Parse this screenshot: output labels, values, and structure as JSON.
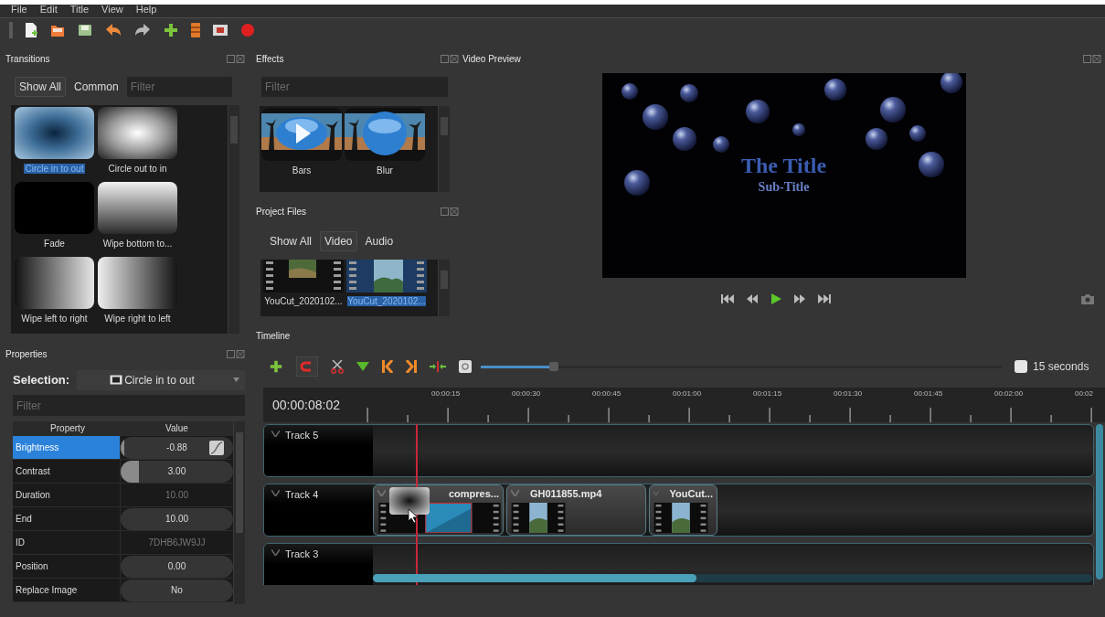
{
  "menu": [
    {
      "label": "File"
    },
    {
      "label": "Edit"
    },
    {
      "label": "Title"
    },
    {
      "label": "View"
    },
    {
      "label": "Help"
    }
  ],
  "transitions": {
    "title": "Transitions",
    "tabs": [
      {
        "label": "Show All",
        "selected": true
      },
      {
        "label": "Common",
        "selected": false
      }
    ],
    "filter": {
      "placeholder": "Filter"
    },
    "items": [
      {
        "label": "Circle in to out",
        "kind": "circle-in",
        "selected": true
      },
      {
        "label": "Circle out to in",
        "kind": "circle-out",
        "selected": false
      },
      {
        "label": "Fade",
        "kind": "fade",
        "selected": false
      },
      {
        "label": "Wipe bottom to...",
        "kind": "wipe-bottom",
        "selected": false
      },
      {
        "label": "Wipe left to right",
        "kind": "wipe-left",
        "selected": false
      },
      {
        "label": "Wipe right to left",
        "kind": "wipe-right",
        "selected": false
      }
    ]
  },
  "effects": {
    "title": "Effects",
    "filter": {
      "placeholder": "Filter"
    },
    "items": [
      {
        "label": "Bars",
        "kind": "play"
      },
      {
        "label": "Blur",
        "kind": "sphere"
      }
    ]
  },
  "project_files": {
    "title": "Project Files",
    "tabs": [
      {
        "label": "Show All",
        "selected": false
      },
      {
        "label": "Video",
        "selected": true
      },
      {
        "label": "Audio",
        "selected": false
      }
    ],
    "files": [
      {
        "name": "YouCut_2020102...",
        "selected": false
      },
      {
        "name": "YouCut_2020102...",
        "selected": true
      }
    ]
  },
  "preview": {
    "title": "Video Preview",
    "title_text": "The Title",
    "subtitle": "Sub-Title"
  },
  "properties": {
    "title": "Properties",
    "selection_label": "Selection:",
    "selection": "Circle in to out",
    "filter": {
      "placeholder": "Filter"
    },
    "columns": [
      "Property",
      "Value"
    ],
    "rows": [
      {
        "name": "Brightness",
        "value": "-0.88",
        "kind": "slider",
        "level": 0.03,
        "keyframe": true,
        "selected": true
      },
      {
        "name": "Contrast",
        "value": "3.00",
        "kind": "slider",
        "level": 0.16,
        "selected": false
      },
      {
        "name": "Duration",
        "value": "10.00",
        "kind": "readonly",
        "selected": false
      },
      {
        "name": "End",
        "value": "10.00",
        "kind": "pill",
        "selected": false
      },
      {
        "name": "ID",
        "value": "7DHB6JW9JJ",
        "kind": "readonly",
        "selected": false
      },
      {
        "name": "Position",
        "value": "0.00",
        "kind": "pill",
        "selected": false
      },
      {
        "name": "Replace Image",
        "value": "No",
        "kind": "pill",
        "selected": false
      }
    ]
  },
  "timeline": {
    "title": "Timeline",
    "zoom": {
      "level": 0.14,
      "label": "15 seconds"
    },
    "time": "00:00:08:02",
    "ruler": [
      "00:00:15",
      "00:00:30",
      "00:00:45",
      "00:01:00",
      "00:01:15",
      "00:01:30",
      "00:01:45",
      "00:02:00",
      "00:02"
    ],
    "tracks": [
      {
        "name": "Track 5"
      },
      {
        "name": "Track 4",
        "clips": [
          {
            "name": "compres...",
            "selected": true
          },
          {
            "name": "GH011855.mp4",
            "selected": false
          },
          {
            "name": "YouCut...",
            "selected": false
          }
        ]
      },
      {
        "name": "Track 3"
      }
    ]
  }
}
